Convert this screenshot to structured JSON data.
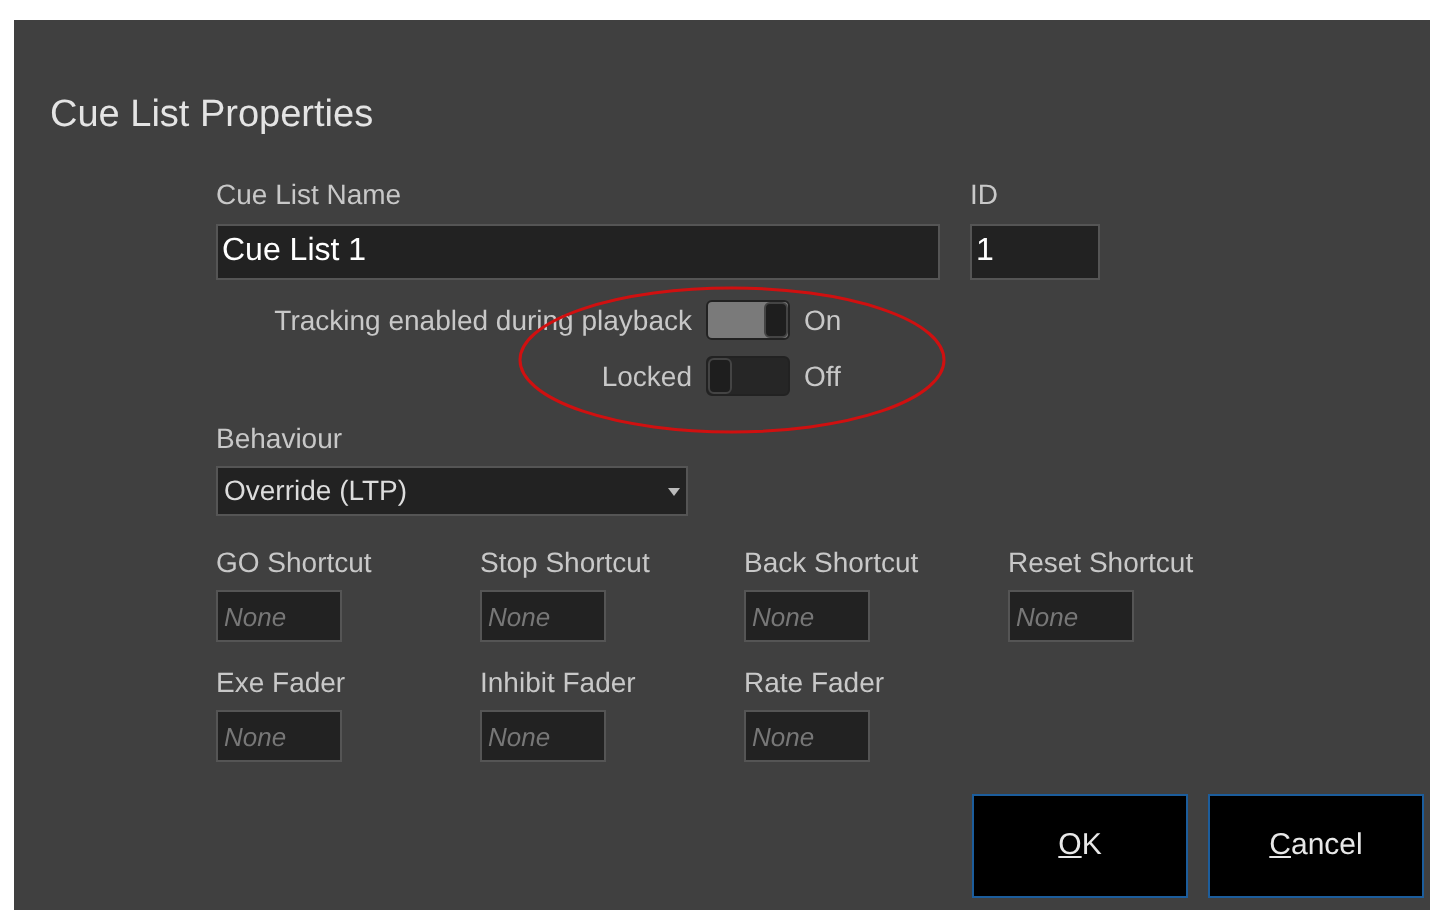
{
  "dialog": {
    "title": "Cue List Properties"
  },
  "name_field": {
    "label": "Cue List Name",
    "value": "Cue List 1"
  },
  "id_field": {
    "label": "ID",
    "value": "1"
  },
  "toggles": [
    {
      "label": "Tracking enabled during playback",
      "on": true,
      "state_text": "On"
    },
    {
      "label": "Locked",
      "on": false,
      "state_text": "Off"
    }
  ],
  "behaviour": {
    "label": "Behaviour",
    "value": "Override (LTP)"
  },
  "shortcut_rows": [
    [
      {
        "label": "GO Shortcut",
        "placeholder": "None"
      },
      {
        "label": "Stop Shortcut",
        "placeholder": "None"
      },
      {
        "label": "Back Shortcut",
        "placeholder": "None"
      },
      {
        "label": "Reset Shortcut",
        "placeholder": "None"
      }
    ],
    [
      {
        "label": "Exe Fader",
        "placeholder": "None"
      },
      {
        "label": "Inhibit Fader",
        "placeholder": "None"
      },
      {
        "label": "Rate Fader",
        "placeholder": "None"
      }
    ]
  ],
  "buttons": [
    {
      "label": "OK",
      "first_letter_underlined": true
    },
    {
      "label": "Cancel",
      "first_letter_underlined": true
    }
  ],
  "annotation": {
    "kind": "ellipse",
    "color": "#d01010"
  }
}
